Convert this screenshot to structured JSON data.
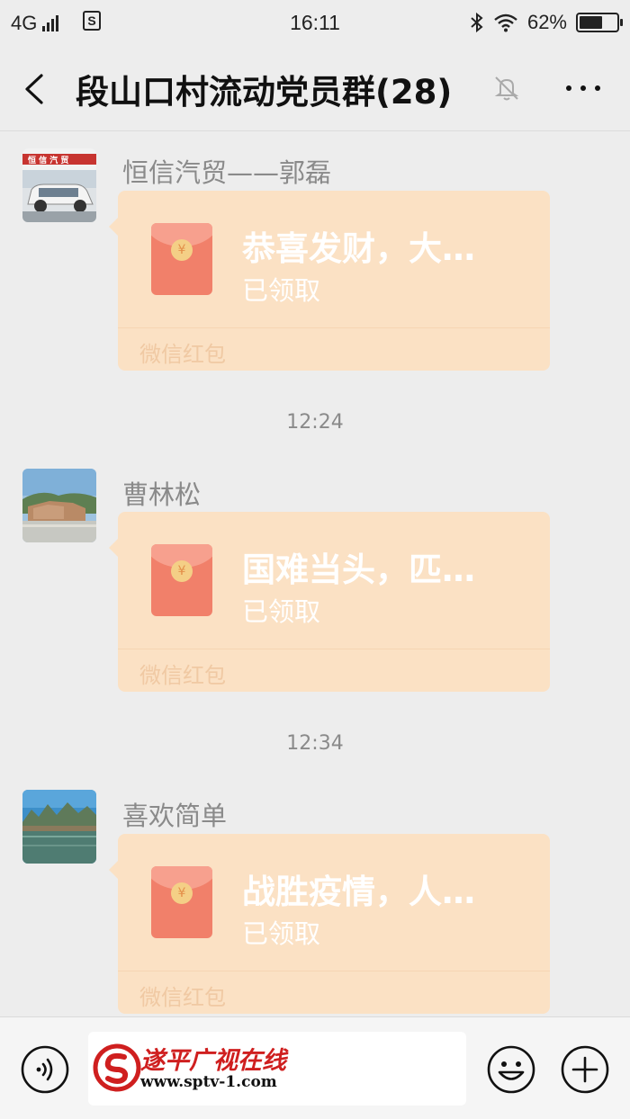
{
  "status_bar": {
    "network": "4G",
    "time": "16:11",
    "battery_percent_text": "62%",
    "battery_level": 0.62,
    "icons": [
      "signal-icon",
      "notification-icon",
      "bluetooth-icon",
      "wifi-icon",
      "battery-icon"
    ]
  },
  "nav": {
    "back_icon": "chevron-left-icon",
    "title": "段山口村流动党员群(28)",
    "mute_icon": "bell-off-icon",
    "more_icon": "more-dots-icon"
  },
  "messages": [
    {
      "sender": "恒信汽贸——郭磊",
      "packet_title": "恭喜发财，大…",
      "packet_status": "已领取",
      "packet_brand": "微信红包"
    },
    {
      "time": "12:24"
    },
    {
      "sender": "曹林松",
      "packet_title": "国难当头，匹…",
      "packet_status": "已领取",
      "packet_brand": "微信红包"
    },
    {
      "time": "12:34"
    },
    {
      "sender": "喜欢简单",
      "packet_title": "战胜疫情，人…",
      "packet_status": "已领取",
      "packet_brand": "微信红包"
    }
  ],
  "avatar_1_sign": "恒 信 汽 贸",
  "input_bar": {
    "voice_icon": "voice-icon",
    "emoji_icon": "emoji-icon",
    "plus_icon": "plus-icon"
  },
  "watermark": {
    "name": "遂平广视在线",
    "url": "www.sptv-1.com"
  },
  "colors": {
    "packet_bg": "#fbe1c4",
    "envelope": "#f1806a",
    "chat_bg": "#ededed"
  }
}
